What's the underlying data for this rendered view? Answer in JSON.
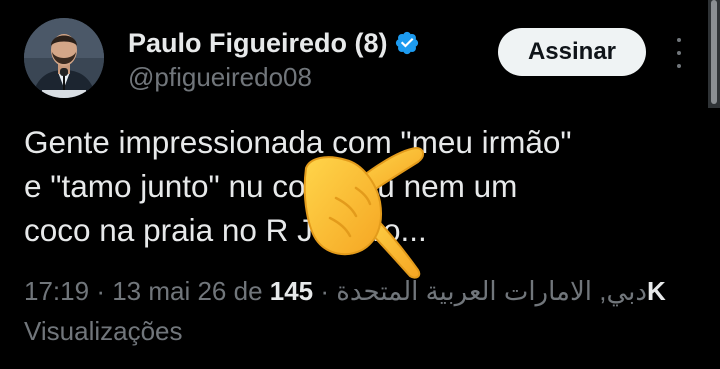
{
  "author": {
    "name": "Paulo Figueiredo (8)",
    "handle": "@pfigueiredo08",
    "verified": true,
    "verified_color": "#1d9bf0"
  },
  "header": {
    "subscribe_label": "Assinar",
    "more_icon": "more-vertical-icon"
  },
  "tweet": {
    "lines": [
      "Gente impressionada com \"meu irmão\"",
      "e \"tamo junto\" nu     comprou nem um",
      "coco na praia no R      Janeiro..."
    ]
  },
  "meta": {
    "time": "17:19",
    "date": "13 mai 26 de دبي, الامارات العربية المتحدة",
    "views_count": "145K",
    "views_label": "Visualizações",
    "separator": "·"
  },
  "overlay": {
    "emoji": "pointing-hand-emoji"
  },
  "colors": {
    "background": "#000000",
    "text": "#e7e9ea",
    "secondary_text": "#71767b",
    "button_bg": "#eff3f4",
    "button_text": "#0f1419"
  }
}
